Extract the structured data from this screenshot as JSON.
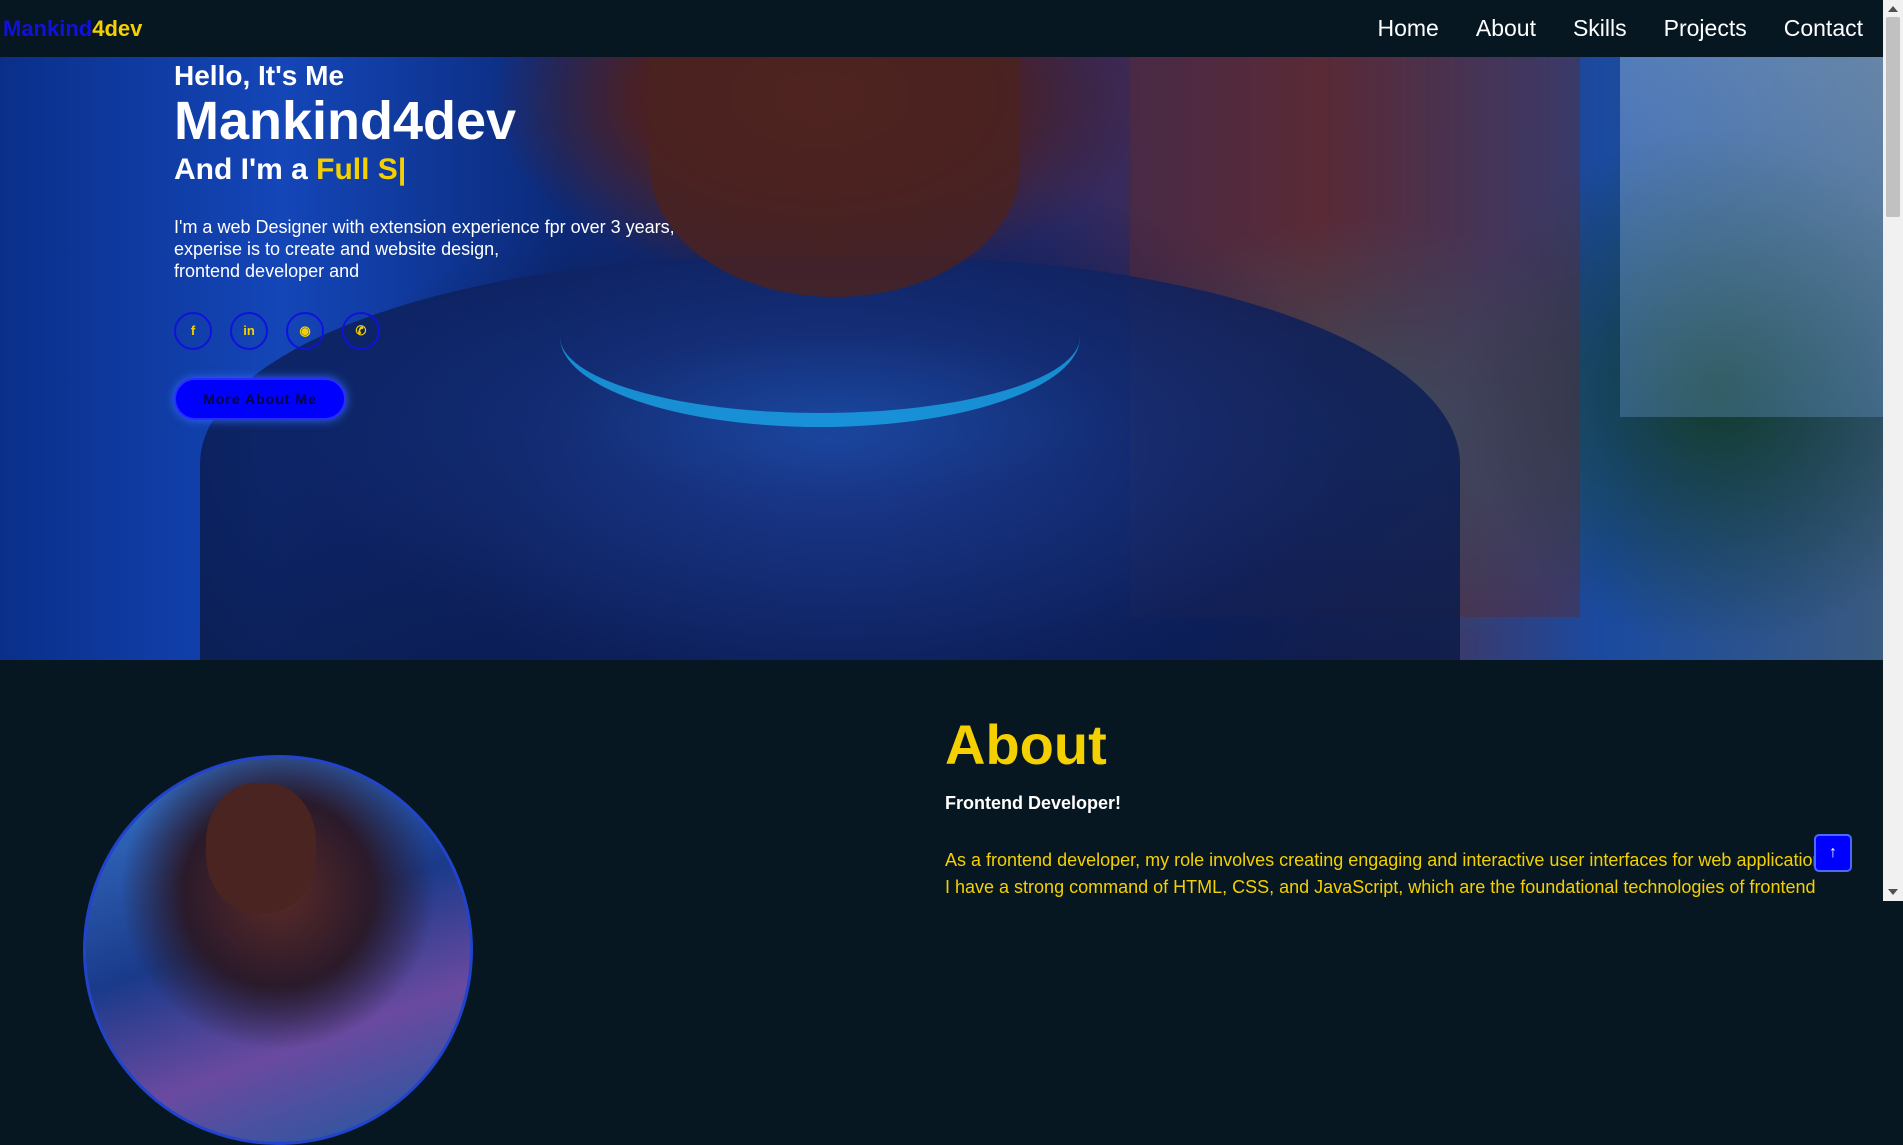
{
  "nav": {
    "logo_part1": "Mankind",
    "logo_part2": "4dev",
    "links": [
      "Home",
      "About",
      "Skills",
      "Projects",
      "Contact"
    ]
  },
  "hero": {
    "hello": "Hello, It's Me",
    "name": "Mankind4dev",
    "role_prefix": "And I'm a ",
    "role_typed": "Full S|",
    "description": [
      "I'm a web Designer with extension experience fpr over 3 years,",
      "experise is to create and website design,",
      "frontend developer and"
    ],
    "socials": [
      {
        "icon": "facebook-icon",
        "glyph": "f"
      },
      {
        "icon": "linkedin-icon",
        "glyph": "in"
      },
      {
        "icon": "github-icon",
        "glyph": "◉"
      },
      {
        "icon": "whatsapp-icon",
        "glyph": "✆"
      }
    ],
    "cta_label": "More About Me"
  },
  "about": {
    "title": "About",
    "subtitle": "Frontend Developer!",
    "text_lines": [
      "As a frontend developer, my role involves creating engaging and interactive user interfaces for web applications.",
      "I have a strong command of HTML, CSS, and JavaScript, which are the foundational technologies of frontend"
    ]
  },
  "scroll_top": {
    "icon": "arrow-up-icon",
    "glyph": "↑"
  },
  "colors": {
    "accent": "#f5d000",
    "primary": "#0000ff",
    "background": "#061722"
  }
}
